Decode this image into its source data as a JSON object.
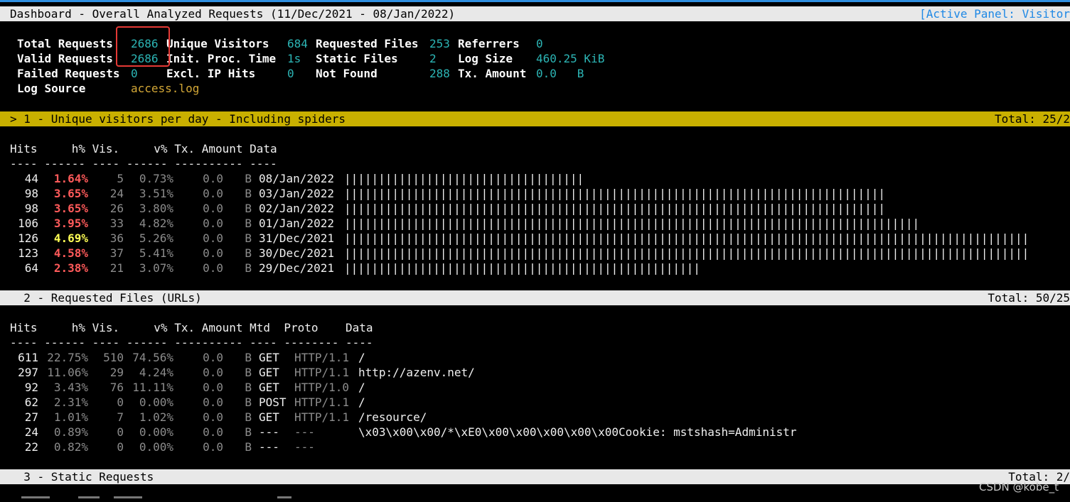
{
  "header": {
    "title": "Dashboard - Overall Analyzed Requests (11/Dec/2021 - 08/Jan/2022)",
    "active_panel": "[Active Panel: Visitor"
  },
  "overall": {
    "total_requests_label": "Total Requests",
    "total_requests": "2686",
    "valid_requests_label": "Valid Requests",
    "valid_requests": "2686",
    "failed_requests_label": "Failed Requests",
    "failed_requests": "0",
    "log_source_label": "Log Source",
    "log_source": "access.log",
    "unique_visitors_label": "Unique Visitors",
    "unique_visitors": "684",
    "init_proc_time_label": "Init. Proc. Time",
    "init_proc_time": "1s",
    "excl_ip_hits_label": "Excl. IP Hits",
    "excl_ip_hits": "0",
    "requested_files_label": "Requested Files",
    "requested_files": "253",
    "static_files_label": "Static Files",
    "static_files": "2",
    "not_found_label": "Not Found",
    "not_found": "288",
    "referrers_label": "Referrers",
    "referrers": "0",
    "log_size_label": "Log Size",
    "log_size": "460.25 KiB",
    "tx_amount_label": "Tx. Amount",
    "tx_amount": "0.0   B"
  },
  "panel1": {
    "title": "> 1 - Unique visitors per day - Including spiders",
    "total": "Total: 25/2",
    "col_header": "Hits     h% Vis.     v% Tx. Amount Data",
    "col_rule": "---- ------ ---- ------ ---------- ----",
    "rows": [
      {
        "hits": "44",
        "hp": "1.64%",
        "vis": "5",
        "vp": "0.73%",
        "tx": "0.0",
        "unit": "B",
        "date": "08/Jan/2022",
        "bars": "|||||||||||||||||||||||||||||||||||",
        "hp_color": "red"
      },
      {
        "hits": "98",
        "hp": "3.65%",
        "vis": "24",
        "vp": "3.51%",
        "tx": "0.0",
        "unit": "B",
        "date": "03/Jan/2022",
        "bars": "|||||||||||||||||||||||||||||||||||||||||||||||||||||||||||||||||||||||||||||||",
        "hp_color": "red"
      },
      {
        "hits": "98",
        "hp": "3.65%",
        "vis": "26",
        "vp": "3.80%",
        "tx": "0.0",
        "unit": "B",
        "date": "02/Jan/2022",
        "bars": "|||||||||||||||||||||||||||||||||||||||||||||||||||||||||||||||||||||||||||||||",
        "hp_color": "red"
      },
      {
        "hits": "106",
        "hp": "3.95%",
        "vis": "33",
        "vp": "4.82%",
        "tx": "0.0",
        "unit": "B",
        "date": "01/Jan/2022",
        "bars": "||||||||||||||||||||||||||||||||||||||||||||||||||||||||||||||||||||||||||||||||||||",
        "hp_color": "red"
      },
      {
        "hits": "126",
        "hp": "4.69%",
        "vis": "36",
        "vp": "5.26%",
        "tx": "0.0",
        "unit": "B",
        "date": "31/Dec/2021",
        "bars": "||||||||||||||||||||||||||||||||||||||||||||||||||||||||||||||||||||||||||||||||||||||||||||||||||||",
        "hp_color": "yellow"
      },
      {
        "hits": "123",
        "hp": "4.58%",
        "vis": "37",
        "vp": "5.41%",
        "tx": "0.0",
        "unit": "B",
        "date": "30/Dec/2021",
        "bars": "||||||||||||||||||||||||||||||||||||||||||||||||||||||||||||||||||||||||||||||||||||||||||||||||||||",
        "hp_color": "red"
      },
      {
        "hits": "64",
        "hp": "2.38%",
        "vis": "21",
        "vp": "3.07%",
        "tx": "0.0",
        "unit": "B",
        "date": "29/Dec/2021",
        "bars": "||||||||||||||||||||||||||||||||||||||||||||||||||||",
        "hp_color": "red"
      }
    ]
  },
  "panel2": {
    "title": "  2 - Requested Files (URLs)",
    "total": "Total: 50/25",
    "col_header": "Hits     h% Vis.     v% Tx. Amount Mtd  Proto    Data",
    "col_rule": "---- ------ ---- ------ ---------- ---- -------- ----",
    "rows": [
      {
        "hits": "611",
        "hp": "22.75%",
        "vis": "510",
        "vp": "74.56%",
        "tx": "0.0",
        "unit": "B",
        "mtd": "GET",
        "proto": "HTTP/1.1",
        "data": "/"
      },
      {
        "hits": "297",
        "hp": "11.06%",
        "vis": "29",
        "vp": "4.24%",
        "tx": "0.0",
        "unit": "B",
        "mtd": "GET",
        "proto": "HTTP/1.1",
        "data": "http://azenv.net/"
      },
      {
        "hits": "92",
        "hp": "3.43%",
        "vis": "76",
        "vp": "11.11%",
        "tx": "0.0",
        "unit": "B",
        "mtd": "GET",
        "proto": "HTTP/1.0",
        "data": "/"
      },
      {
        "hits": "62",
        "hp": "2.31%",
        "vis": "0",
        "vp": "0.00%",
        "tx": "0.0",
        "unit": "B",
        "mtd": "POST",
        "proto": "HTTP/1.1",
        "data": "/"
      },
      {
        "hits": "27",
        "hp": "1.01%",
        "vis": "7",
        "vp": "1.02%",
        "tx": "0.0",
        "unit": "B",
        "mtd": "GET",
        "proto": "HTTP/1.1",
        "data": "/resource/"
      },
      {
        "hits": "24",
        "hp": "0.89%",
        "vis": "0",
        "vp": "0.00%",
        "tx": "0.0",
        "unit": "B",
        "mtd": "---",
        "proto": "---",
        "data": "\\x03\\x00\\x00/*\\xE0\\x00\\x00\\x00\\x00\\x00Cookie: mstshash=Administr"
      },
      {
        "hits": "22",
        "hp": "0.82%",
        "vis": "0",
        "vp": "0.00%",
        "tx": "0.0",
        "unit": "B",
        "mtd": "---",
        "proto": "---",
        "data": ""
      }
    ]
  },
  "panel3": {
    "title": "  3 - Static Requests",
    "total": "Total: 2/"
  },
  "watermark": "CSDN @kobe_t"
}
